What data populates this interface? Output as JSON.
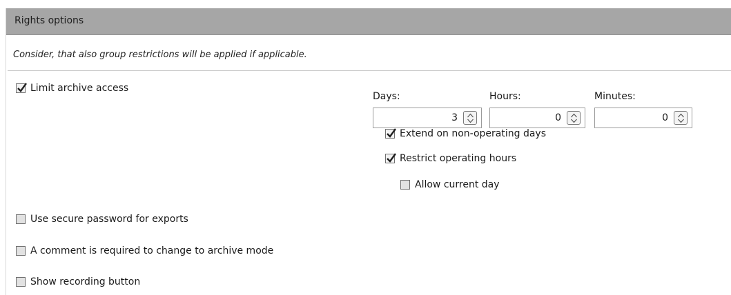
{
  "panel": {
    "title": "Rights options",
    "note": "Consider, that also group restrictions will be applied if applicable."
  },
  "options": {
    "limit_archive_access": {
      "label": "Limit archive access",
      "checked": true
    },
    "extend_non_operating": {
      "label": "Extend on non-operating days",
      "checked": true
    },
    "restrict_operating_hours": {
      "label": "Restrict operating hours",
      "checked": true
    },
    "allow_current_day": {
      "label": "Allow current day",
      "checked": false
    },
    "secure_password": {
      "label": "Use secure password for exports",
      "checked": false
    },
    "comment_required": {
      "label": "A comment is required to change to archive mode",
      "checked": false
    },
    "show_recording_button": {
      "label": "Show recording button",
      "checked": false
    }
  },
  "limits": {
    "days": {
      "label": "Days:",
      "value": "3"
    },
    "hours": {
      "label": "Hours:",
      "value": "0"
    },
    "minutes": {
      "label": "Minutes:",
      "value": "0"
    }
  }
}
